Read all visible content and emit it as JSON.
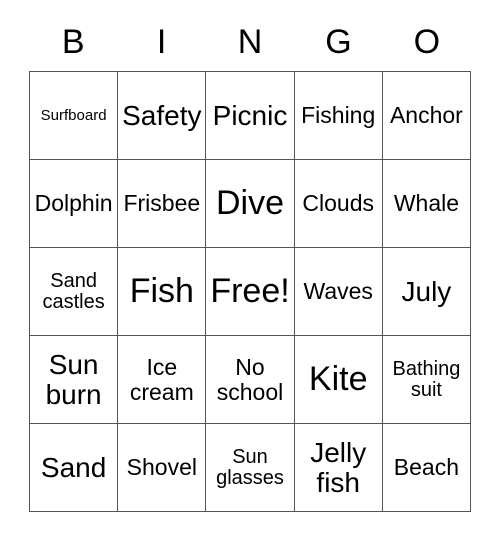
{
  "card": {
    "header": {
      "letters": [
        "B",
        "I",
        "N",
        "G",
        "O"
      ]
    },
    "grid": {
      "rows": [
        {
          "cells": [
            {
              "text": "Surfboard",
              "size": "fs-xs"
            },
            {
              "text": "Safety",
              "size": "fs-l"
            },
            {
              "text": "Picnic",
              "size": "fs-l"
            },
            {
              "text": "Fishing",
              "size": "fs-m"
            },
            {
              "text": "Anchor",
              "size": "fs-m"
            }
          ]
        },
        {
          "cells": [
            {
              "text": "Dolphin",
              "size": "fs-m"
            },
            {
              "text": "Frisbee",
              "size": "fs-m"
            },
            {
              "text": "Dive",
              "size": "fs-xl"
            },
            {
              "text": "Clouds",
              "size": "fs-m"
            },
            {
              "text": "Whale",
              "size": "fs-m"
            }
          ]
        },
        {
          "cells": [
            {
              "text": "Sand\ncastles",
              "size": "fs-s"
            },
            {
              "text": "Fish",
              "size": "fs-xl"
            },
            {
              "text": "Free!",
              "size": "fs-xl"
            },
            {
              "text": "Waves",
              "size": "fs-m"
            },
            {
              "text": "July",
              "size": "fs-l"
            }
          ]
        },
        {
          "cells": [
            {
              "text": "Sun\nburn",
              "size": "fs-l"
            },
            {
              "text": "Ice\ncream",
              "size": "fs-m"
            },
            {
              "text": "No\nschool",
              "size": "fs-m"
            },
            {
              "text": "Kite",
              "size": "fs-xl"
            },
            {
              "text": "Bathing\nsuit",
              "size": "fs-s"
            }
          ]
        },
        {
          "cells": [
            {
              "text": "Sand",
              "size": "fs-l"
            },
            {
              "text": "Shovel",
              "size": "fs-m"
            },
            {
              "text": "Sun\nglasses",
              "size": "fs-s"
            },
            {
              "text": "Jelly\nfish",
              "size": "fs-l"
            },
            {
              "text": "Beach",
              "size": "fs-m"
            }
          ]
        }
      ]
    }
  },
  "colors": {
    "background": "#ffffff",
    "text": "#000000",
    "border": "#555555"
  }
}
